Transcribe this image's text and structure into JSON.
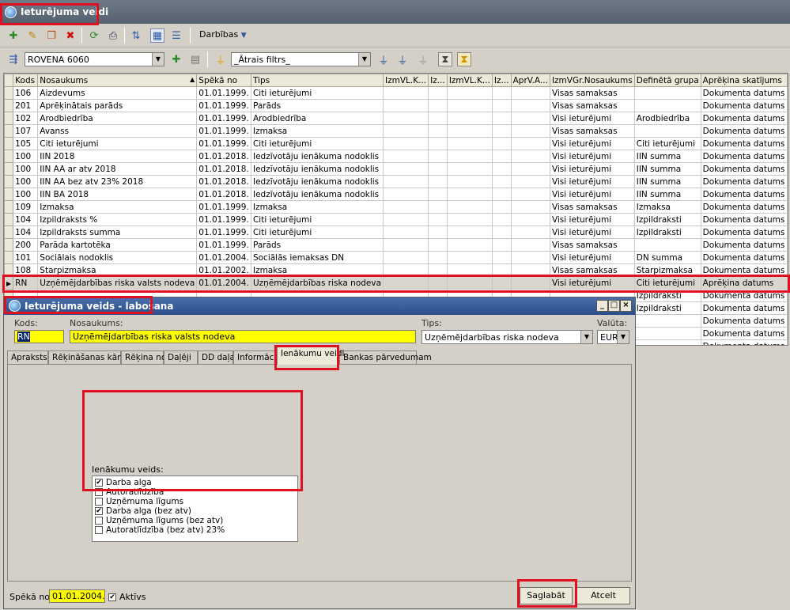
{
  "main": {
    "title": "Ieturējuma veidi",
    "darbibas_label": "Darbības",
    "company_combo": "ROVENA 6060",
    "filter_combo": "_Ātrais filtrs_"
  },
  "grid": {
    "columns": [
      "Kods",
      "Nosaukums",
      "Spēkā no",
      "Tips",
      "IzmVL.K...",
      "Iz...",
      "IzmVL.K...",
      "Iz...",
      "AprV.A...",
      "IzmVGr.Nosaukums",
      "Definētā grupa",
      "Aprēķina skatījums"
    ],
    "rows": [
      [
        "106",
        "Aizdevums",
        "01.01.1999.",
        "Citi ieturējumi",
        "",
        "",
        "",
        "",
        "",
        "Visas samaksas",
        "",
        "Dokumenta datums"
      ],
      [
        "201",
        "Aprēķinātais parāds",
        "01.01.1999.",
        "Parāds",
        "",
        "",
        "",
        "",
        "",
        "Visas samaksas",
        "",
        "Dokumenta datums"
      ],
      [
        "102",
        "Arodbiedrība",
        "01.01.1999.",
        "Arodbiedrība",
        "",
        "",
        "",
        "",
        "",
        "Visi ieturējumi",
        "Arodbiedrība",
        "Dokumenta datums"
      ],
      [
        "107",
        "Avanss",
        "01.01.1999.",
        "Izmaksa",
        "",
        "",
        "",
        "",
        "",
        "Visas samaksas",
        "",
        "Dokumenta datums"
      ],
      [
        "105",
        "Citi ieturējumi",
        "01.01.1999.",
        "Citi ieturējumi",
        "",
        "",
        "",
        "",
        "",
        "Visi ieturējumi",
        "Citi ieturējumi",
        "Dokumenta datums"
      ],
      [
        "100",
        "IIN 2018",
        "01.01.2018.",
        "Iedzīvotāju ienākuma nodoklis",
        "",
        "",
        "",
        "",
        "",
        "Visi ieturējumi",
        "IIN summa",
        "Dokumenta datums"
      ],
      [
        "100",
        "IIN AA ar atv 2018",
        "01.01.2018.",
        "Iedzīvotāju ienākuma nodoklis",
        "",
        "",
        "",
        "",
        "",
        "Visi ieturējumi",
        "IIN summa",
        "Dokumenta datums"
      ],
      [
        "100",
        "IIN AA bez atv 23% 2018",
        "01.01.2018.",
        "Iedzīvotāju ienākuma nodoklis",
        "",
        "",
        "",
        "",
        "",
        "Visi ieturējumi",
        "IIN summa",
        "Dokumenta datums"
      ],
      [
        "100",
        "IIN BA 2018",
        "01.01.2018.",
        "Iedzīvotāju ienākuma nodoklis",
        "",
        "",
        "",
        "",
        "",
        "Visi ieturējumi",
        "IIN summa",
        "Dokumenta datums"
      ],
      [
        "109",
        "Izmaksa",
        "01.01.1999.",
        "Izmaksa",
        "",
        "",
        "",
        "",
        "",
        "Visas samaksas",
        "Izmaksa",
        "Dokumenta datums"
      ],
      [
        "104",
        "Izpildraksts %",
        "01.01.1999.",
        "Citi ieturējumi",
        "",
        "",
        "",
        "",
        "",
        "Visi ieturējumi",
        "Izpildraksti",
        "Dokumenta datums"
      ],
      [
        "104",
        "Izpildraksts summa",
        "01.01.1999.",
        "Citi ieturējumi",
        "",
        "",
        "",
        "",
        "",
        "Visi ieturējumi",
        "Izpildraksti",
        "Dokumenta datums"
      ],
      [
        "200",
        "Parāda kartotēka",
        "01.01.1999.",
        "Parāds",
        "",
        "",
        "",
        "",
        "",
        "Visas samaksas",
        "",
        "Dokumenta datums"
      ],
      [
        "101",
        "Sociālais nodoklis",
        "01.01.2004.",
        "Sociālās iemaksas DN",
        "",
        "",
        "",
        "",
        "",
        "Visi ieturējumi",
        "DN summa",
        "Dokumenta datums"
      ],
      [
        "108",
        "Starpizmaksa",
        "01.01.2002.",
        "Izmaksa",
        "",
        "",
        "",
        "",
        "",
        "Visas samaksas",
        "Starpizmaksa",
        "Dokumenta datums"
      ],
      [
        "RN",
        "Uzņēmējdarbības riska valsts nodeva",
        "01.01.2004.",
        "Uzņēmējdarbības riska nodeva",
        "",
        "",
        "",
        "",
        "",
        "Visi ieturējumi",
        "Citi ieturējumi",
        "Aprēķina datums"
      ],
      [
        "",
        "",
        "",
        "",
        "",
        "",
        "",
        "",
        "",
        "",
        "Izpildraksti",
        "Dokumenta datums"
      ],
      [
        "",
        "",
        "",
        "",
        "",
        "",
        "",
        "",
        "",
        "",
        "Izpildraksti",
        "Dokumenta datums"
      ],
      [
        "",
        "",
        "",
        "",
        "",
        "",
        "",
        "",
        "",
        "",
        "",
        "Dokumenta datums"
      ],
      [
        "",
        "",
        "",
        "",
        "",
        "",
        "",
        "",
        "",
        "",
        "",
        "Dokumenta datums"
      ],
      [
        "",
        "",
        "",
        "",
        "",
        "",
        "",
        "",
        "",
        "",
        "",
        "Dokumenta datums"
      ]
    ],
    "selected_index": 15
  },
  "dialog": {
    "title": "Ieturējuma veids - labošana",
    "labels": {
      "kods": "Kods:",
      "nosaukums": "Nosaukums:",
      "tips": "Tips:",
      "valuta": "Valūta:",
      "speka_no": "Spēkā no:"
    },
    "values": {
      "kods": "RN",
      "nosaukums": "Uzņēmējdarbības riska valsts nodeva",
      "tips": "Uzņēmējdarbības riska nodeva",
      "valuta": "EUR",
      "speka_no": "01.01.2004."
    },
    "tabs": [
      "Apraksts",
      "Rēķināšanas kārtība",
      "Rēķina no",
      "Daļēji",
      "DD daļa",
      "Informācija",
      "Ienākumu veidi",
      "Bankas pārvedumam"
    ],
    "active_tab": "Ienākumu veidi",
    "ienakumu_label": "Ienākumu veids:",
    "ienakumu": [
      {
        "label": "Darba alga",
        "checked": true
      },
      {
        "label": "Autoratlīdzība",
        "checked": false
      },
      {
        "label": "Uzņēmuma līgums",
        "checked": false
      },
      {
        "label": "Darba alga (bez atv)",
        "checked": true
      },
      {
        "label": "Uzņēmuma līgums (bez atv)",
        "checked": false
      },
      {
        "label": "Autoratlīdzība (bez atv) 23%",
        "checked": false
      }
    ],
    "aktivs_label": "Aktīvs",
    "aktivs_checked": true,
    "save_label": "Saglabāt",
    "cancel_label": "Atcelt"
  }
}
